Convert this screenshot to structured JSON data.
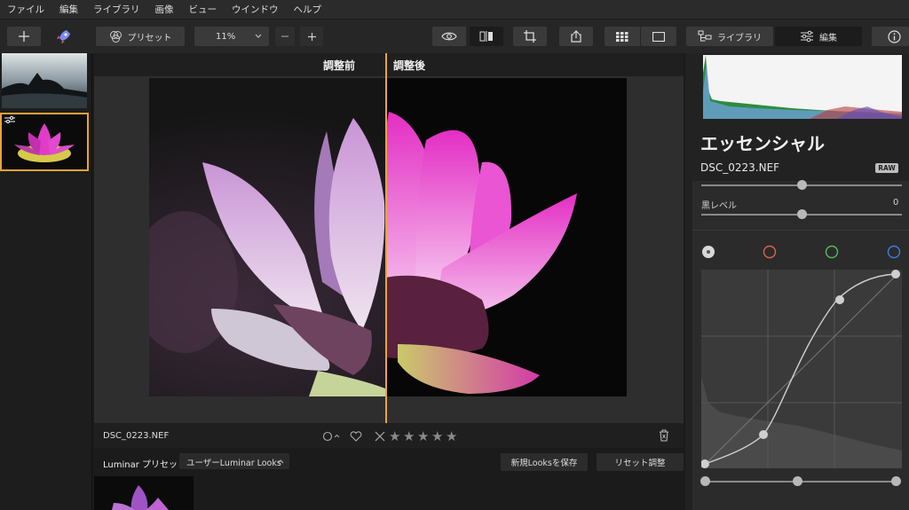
{
  "menu": [
    "ファイル",
    "編集",
    "ライブラリ",
    "画像",
    "ビュー",
    "ウインドウ",
    "ヘルプ"
  ],
  "toolbar": {
    "add_icon": "plus-icon",
    "launch_icon": "rocket-icon",
    "preset_label": "プリセット",
    "zoom_value": "11%",
    "zoom_out_icon": "minus-icon",
    "zoom_in_icon": "plus-icon",
    "library_label": "ライブラリ",
    "edit_label": "編集"
  },
  "compare": {
    "before_label": "調整前",
    "after_label": "調整後"
  },
  "infobar": {
    "file_name": "DSC_0223.NEF",
    "rating": 0,
    "rating_max": 5
  },
  "presets": {
    "title": "Luminar プリセット",
    "dropdown_value": "ユーザーLuminar Looks",
    "save_looks_label": "新規Looksを保存",
    "reset_label": "リセット調整"
  },
  "panel": {
    "title": "エッセンシャル",
    "file_name": "DSC_0223.NEF",
    "raw_badge": "RAW",
    "black_level_label": "黒レベル",
    "black_level_value": "0",
    "channels": [
      "luminance",
      "red",
      "green",
      "blue"
    ],
    "channel_colors": {
      "luminance": "#d8d8d8",
      "red": "#e0614d",
      "green": "#4fbf5a",
      "blue": "#3b7fe0"
    }
  },
  "colors": {
    "accent": "#e8a33a",
    "background": "#1b1b1b",
    "panel": "#222222"
  }
}
